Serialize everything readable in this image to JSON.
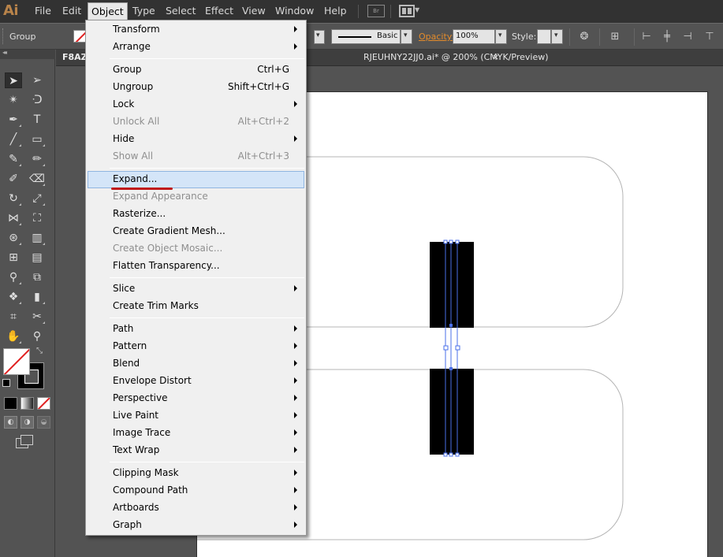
{
  "app": {
    "logo": "Ai"
  },
  "menubar": {
    "items": [
      "File",
      "Edit",
      "Object",
      "Type",
      "Select",
      "Effect",
      "View",
      "Window",
      "Help"
    ],
    "active": "Object",
    "bridge_label": "Br"
  },
  "controlbar": {
    "selection_label": "Group",
    "brush_label": "Basic",
    "opacity_label": "Opacity:",
    "opacity_value": "100%",
    "style_label": "Style:"
  },
  "document": {
    "tab_left": "F8AZ",
    "tab_title": "RJEUHNY22JJ0.ai* @ 200% (CMYK/Preview)",
    "close_glyph": "×"
  },
  "object_menu": {
    "items": [
      {
        "label": "Transform",
        "submenu": true
      },
      {
        "label": "Arrange",
        "submenu": true
      },
      {
        "label": "Group",
        "shortcut": "Ctrl+G"
      },
      {
        "label": "Ungroup",
        "shortcut": "Shift+Ctrl+G"
      },
      {
        "label": "Lock",
        "submenu": true
      },
      {
        "label": "Unlock All",
        "shortcut": "Alt+Ctrl+2",
        "disabled": true
      },
      {
        "label": "Hide",
        "submenu": true
      },
      {
        "label": "Show All",
        "shortcut": "Alt+Ctrl+3",
        "disabled": true
      },
      {
        "label": "Expand...",
        "highlighted": true
      },
      {
        "label": "Expand Appearance",
        "disabled": true
      },
      {
        "label": "Rasterize..."
      },
      {
        "label": "Create Gradient Mesh..."
      },
      {
        "label": "Create Object Mosaic...",
        "disabled": true
      },
      {
        "label": "Flatten Transparency..."
      },
      {
        "label": "Slice",
        "submenu": true
      },
      {
        "label": "Create Trim Marks"
      },
      {
        "label": "Path",
        "submenu": true
      },
      {
        "label": "Pattern",
        "submenu": true
      },
      {
        "label": "Blend",
        "submenu": true
      },
      {
        "label": "Envelope Distort",
        "submenu": true
      },
      {
        "label": "Perspective",
        "submenu": true
      },
      {
        "label": "Live Paint",
        "submenu": true
      },
      {
        "label": "Image Trace",
        "submenu": true
      },
      {
        "label": "Text Wrap",
        "submenu": true
      },
      {
        "label": "Clipping Mask",
        "submenu": true
      },
      {
        "label": "Compound Path",
        "submenu": true
      },
      {
        "label": "Artboards",
        "submenu": true
      },
      {
        "label": "Graph",
        "submenu": true
      }
    ]
  },
  "tools": {
    "type_glyph": "T"
  },
  "colors": {
    "menubar_bg": "#323232",
    "panel_bg": "#535353",
    "menu_bg": "#f0f0f0",
    "menu_highlight": "#d4e5f8",
    "selection_blue": "#4a6fe8",
    "opacity_label": "#e38b2b",
    "annotation_red": "#c01818"
  }
}
